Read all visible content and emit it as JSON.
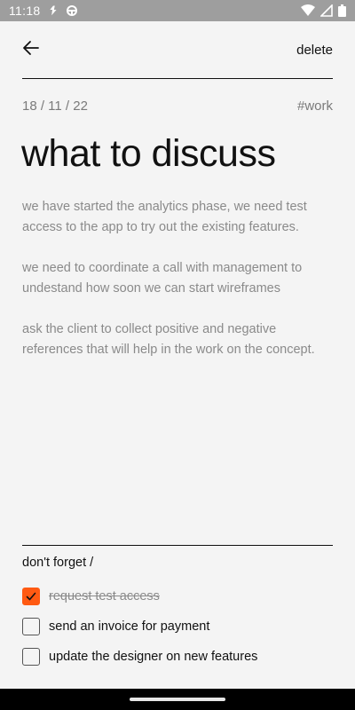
{
  "status_bar": {
    "time": "11:18"
  },
  "top_bar": {
    "delete_label": "delete"
  },
  "note": {
    "date": "18 / 11 / 22",
    "tag": "#work",
    "title": "what to discuss",
    "paragraphs": [
      "we have started the analytics phase, we need test access to the app to try out the existing features.",
      "we need to coordinate a call with management to undestand how soon we can start wireframes",
      "ask the client to collect positive and negative references that will help in the work on the concept."
    ]
  },
  "reminders": {
    "heading": "don't forget /",
    "items": [
      {
        "label": "request test access",
        "checked": true
      },
      {
        "label": "send an invoice for payment",
        "checked": false
      },
      {
        "label": "update the designer on new features",
        "checked": false
      }
    ]
  },
  "colors": {
    "accent": "#ff5a12",
    "background": "#f4f4f4",
    "status_bar": "#9e9e9e"
  }
}
